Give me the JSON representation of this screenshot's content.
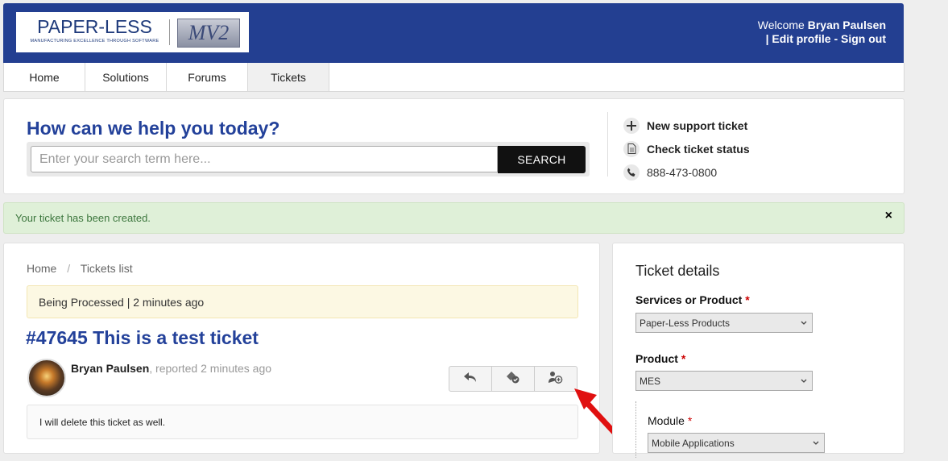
{
  "header": {
    "logo_main": "PAPER-LESS",
    "logo_sub": "MANUFACTURING EXCELLENCE THROUGH SOFTWARE",
    "logo_mv2": "MV2",
    "welcome_label": "Welcome",
    "user_name": "Bryan Paulsen",
    "separator": "|",
    "edit_profile": "Edit profile",
    "dash": "-",
    "sign_out": "Sign out",
    "bg_color": "#233f91"
  },
  "nav": {
    "items": [
      "Home",
      "Solutions",
      "Forums",
      "Tickets"
    ],
    "active": "Tickets"
  },
  "search": {
    "title": "How can we help you today?",
    "placeholder": "Enter your search term here...",
    "button": "SEARCH"
  },
  "quick_links": {
    "new_ticket": "New support ticket",
    "check_status": "Check ticket status",
    "phone": "888-473-0800"
  },
  "alert": {
    "message": "Your ticket has been created.",
    "close": "×"
  },
  "ticket": {
    "breadcrumb": [
      "Home",
      "Tickets list"
    ],
    "breadcrumb_sep": "/",
    "status": "Being Processed | 2 minutes ago",
    "title": "#47645 This is a test ticket",
    "reporter_name": "Bryan Paulsen",
    "reporter_suffix": ", reported 2 minutes ago",
    "comment": "I will delete this ticket as well."
  },
  "details": {
    "title": "Ticket details",
    "fields": [
      {
        "label": "Services or Product",
        "value": "Paper-Less Products"
      },
      {
        "label": "Product",
        "value": "MES"
      },
      {
        "label": "Module",
        "value": "Mobile Applications"
      }
    ],
    "required_mark": "*"
  },
  "colors": {
    "title_blue": "#23419a",
    "alert_green": "#dff0d8",
    "status_yellow": "#fcf8e3",
    "arrow_red": "#e01010"
  }
}
